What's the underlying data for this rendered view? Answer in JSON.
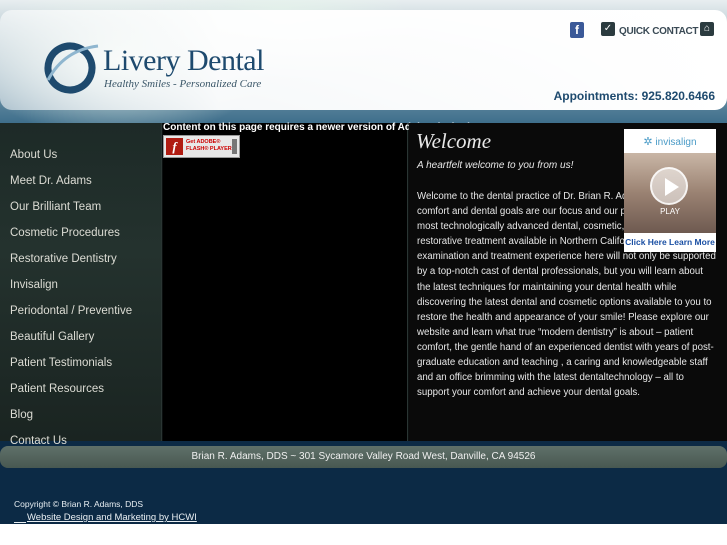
{
  "header": {
    "logo_name": "Livery Dental",
    "logo_tagline": "Healthy Smiles - Personalized Care",
    "facebook_icon": "f",
    "quick_contact_label": "QUICK CONTACT",
    "appointments": "Appointments: 925.820.6466"
  },
  "sidebar": {
    "items": [
      {
        "label": "About Us"
      },
      {
        "label": "Meet Dr. Adams"
      },
      {
        "label": "Our Brilliant Team"
      },
      {
        "label": "Cosmetic Procedures"
      },
      {
        "label": "Restorative Dentistry"
      },
      {
        "label": "Invisalign"
      },
      {
        "label": "Periodontal / Preventive"
      },
      {
        "label": "Beautiful Gallery"
      },
      {
        "label": "Patient Testimonials"
      },
      {
        "label": "Patient Resources"
      },
      {
        "label": "Blog"
      },
      {
        "label": "Contact Us"
      }
    ]
  },
  "flash": {
    "message": "Content on this page requires a newer version of Adobe Flash Player.",
    "button_line1": "Get ADOBE®",
    "button_line2": "FLASH® PLAYER"
  },
  "main": {
    "heading": "Welcome",
    "intro": "A heartfelt welcome to you from us!",
    "body": "Welcome to the dental practice of Dr. Brian R. Adams, where your comfort and dental goals are our focus and our passion.  We offer the most technologically advanced dental, cosmetic, endodontic  and restorative treatment available in Northern California.  Your examination and treatment experience here will not only be supported by a top-notch cast of dental professionals, but you will learn about the latest techniques for maintaining your dental health while discovering the latest dental and cosmetic options available to you to restore the health and appearance of your smile!  Please explore our website and learn what true “modern dentistry” is about – patient comfort, the gentle hand of an experienced dentist with years of post-graduate education and teaching , a caring and knowledgeable staff and an office brimming with the latest dentaltechnology – all to support your comfort and achieve your dental goals."
  },
  "invisalign": {
    "brand": "invisalign",
    "play": "PLAY",
    "link": "Click Here Learn More"
  },
  "address": "Brian R. Adams, DDS ~ 301 Sycamore Valley Road West, Danville, CA 94526",
  "footer": {
    "copyright": "Copyright © Brian R. Adams, DDS",
    "credit": "Website Design and Marketing by HCWI"
  },
  "colors": {
    "brand_blue": "#1e4a6e",
    "nav_text": "#dcdcd4",
    "footer_bg": "#0c2a45",
    "link_blue": "#1a4fa3"
  }
}
